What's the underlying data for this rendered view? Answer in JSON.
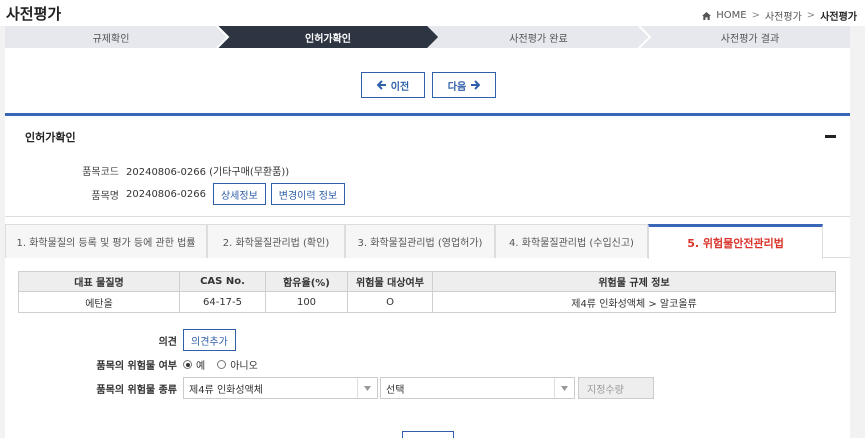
{
  "header": {
    "title": "사전평가",
    "breadcrumb": {
      "home": "HOME",
      "parent": "사전평가",
      "current": "사전평가"
    }
  },
  "steps": [
    "규제확인",
    "인허가확인",
    "사전평가 완료",
    "사전평가 결과"
  ],
  "nav": {
    "prev_label": "이전",
    "next_label": "다음"
  },
  "section": {
    "title": "인허가확인",
    "product_code_label": "품목코드",
    "product_code_value": "20240806-0266 (기타구매(무환품))",
    "product_name_label": "품목명",
    "product_name_value": "20240806-0266",
    "detail_button": "상세정보",
    "history_button": "변경이력 정보"
  },
  "tabs": [
    "1. 화학물질의 등록 및 평가 등에 관한 법률",
    "2. 화학물질관리법 (확인)",
    "3. 화학물질관리법 (영업허가)",
    "4. 화학물질관리법 (수입신고)",
    "5. 위험물안전관리법"
  ],
  "table": {
    "headers": [
      "대표 물질명",
      "CAS No.",
      "함유율(%)",
      "위험물 대상여부",
      "위험물 규제 정보"
    ],
    "rows": [
      [
        "에탄올",
        "64-17-5",
        "100",
        "O",
        "제4류 인화성액체 > 알코올류"
      ]
    ]
  },
  "form": {
    "opinion_label": "의견",
    "opinion_button": "의견추가",
    "hazard_label": "품목의 위험물 여부",
    "yes_label": "예",
    "no_label": "아니오",
    "type_label": "품목의 위험물 종류",
    "type_select_value": "제4류 인화성액체",
    "sub_select_value": "선택",
    "quantity_placeholder": "지정수량"
  },
  "colors": {
    "active_step": "#2e3542",
    "accent": "#3a66b8",
    "active_tab_text": "#d9342b"
  }
}
